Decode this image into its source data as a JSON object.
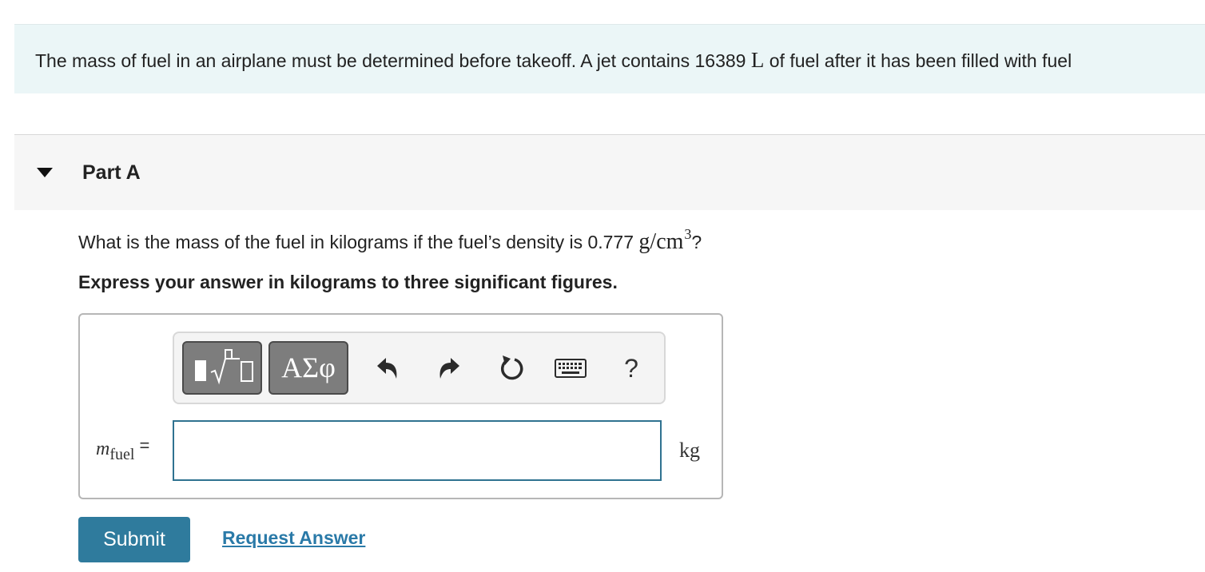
{
  "intro": {
    "text_before": "The mass of fuel in an airplane must be determined before takeoff. A jet contains 16389 ",
    "unit": "L",
    "text_after": " of fuel after it has been filled with fuel"
  },
  "part": {
    "title": "Part A"
  },
  "question": {
    "text_before": "What is the mass of the fuel in kilograms if the fuel’s density is 0.777 ",
    "unit": "g/cm",
    "unit_exponent": "3",
    "text_after": "?"
  },
  "instruction": "Express your answer in kilograms to three significant figures.",
  "toolbar": {
    "templates_icon": "templates-icon",
    "greek_label": "ΑΣφ",
    "undo_icon": "undo-icon",
    "redo_icon": "redo-icon",
    "reset_icon": "reset-icon",
    "keyboard_icon": "keyboard-icon",
    "help_label": "?"
  },
  "answer": {
    "variable": "m",
    "subscript": "fuel",
    "equals": "=",
    "value": "",
    "unit": "kg"
  },
  "actions": {
    "submit_label": "Submit",
    "request_label": "Request Answer"
  },
  "colors": {
    "banner_bg": "#ebf6f7",
    "accent": "#2f7b9d",
    "link": "#2a7aa8"
  }
}
